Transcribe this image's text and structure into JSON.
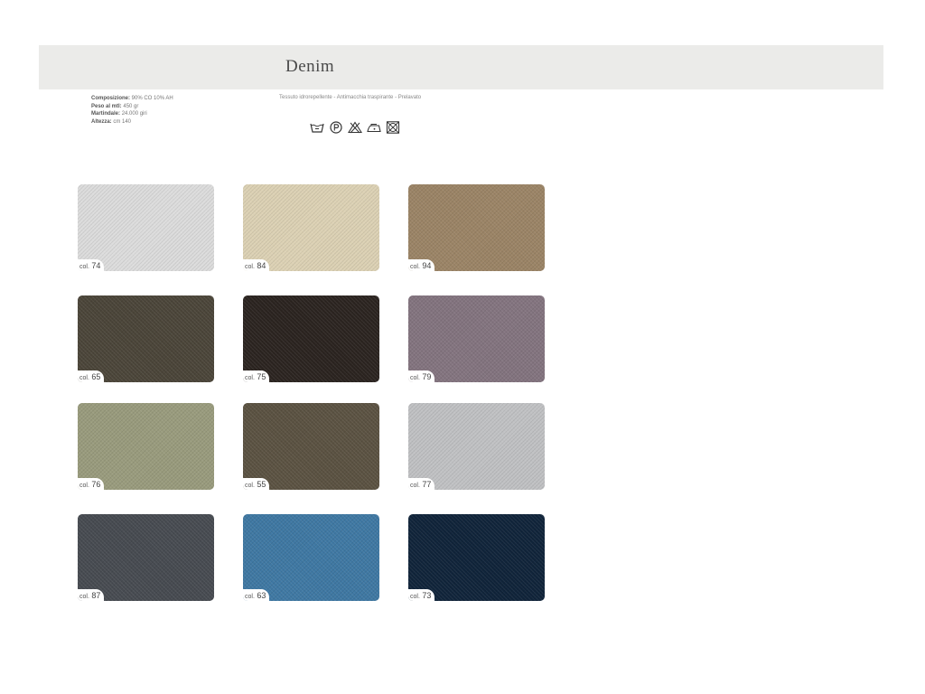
{
  "title": "Denim",
  "specs": [
    {
      "label": "Composizione:",
      "value": "90% CO 10% AH"
    },
    {
      "label": "Peso al mtl:",
      "value": "450 gr"
    },
    {
      "label": "Martindale:",
      "value": "24.000 giri"
    },
    {
      "label": "Altezza:",
      "value": "cm 140"
    }
  ],
  "features": "Tessuto idrorepellente - Antimacchia traspirante - Prelavato",
  "care_icons": [
    "wash-30-icon",
    "dry-clean-p-icon",
    "no-bleach-icon",
    "iron-low-icon",
    "no-tumble-dry-icon"
  ],
  "swatch_prefix": "col.",
  "swatches": [
    {
      "code": "74",
      "color": "#dcdcdc"
    },
    {
      "code": "84",
      "color": "#dcd1b4"
    },
    {
      "code": "94",
      "color": "#9b8466"
    },
    {
      "code": "65",
      "color": "#4b4539"
    },
    {
      "code": "75",
      "color": "#2b2420"
    },
    {
      "code": "79",
      "color": "#83747f"
    },
    {
      "code": "76",
      "color": "#999b7d"
    },
    {
      "code": "55",
      "color": "#5b5242"
    },
    {
      "code": "77",
      "color": "#c0c1c3"
    },
    {
      "code": "87",
      "color": "#474b51"
    },
    {
      "code": "63",
      "color": "#3f78a3"
    },
    {
      "code": "73",
      "color": "#10243a"
    }
  ]
}
